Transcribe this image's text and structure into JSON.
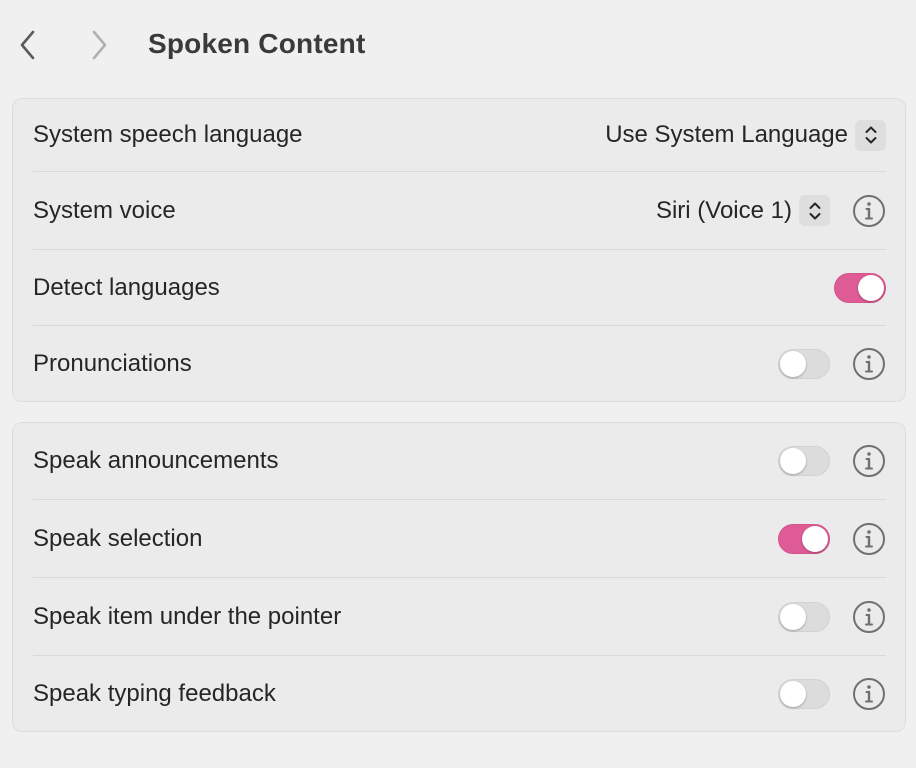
{
  "header": {
    "title": "Spoken Content",
    "back_icon": "chevron-left-icon",
    "forward_icon": "chevron-right-icon"
  },
  "accent_color": "#de5b95",
  "group1": {
    "speech_language": {
      "label": "System speech language",
      "value": "Use System Language"
    },
    "voice": {
      "label": "System voice",
      "value": "Siri (Voice 1)"
    },
    "detect_languages": {
      "label": "Detect languages",
      "on": true
    },
    "pronunciations": {
      "label": "Pronunciations",
      "on": false
    }
  },
  "group2": {
    "announcements": {
      "label": "Speak announcements",
      "on": false
    },
    "selection": {
      "label": "Speak selection",
      "on": true
    },
    "pointer": {
      "label": "Speak item under the pointer",
      "on": false
    },
    "typing": {
      "label": "Speak typing feedback",
      "on": false
    }
  }
}
